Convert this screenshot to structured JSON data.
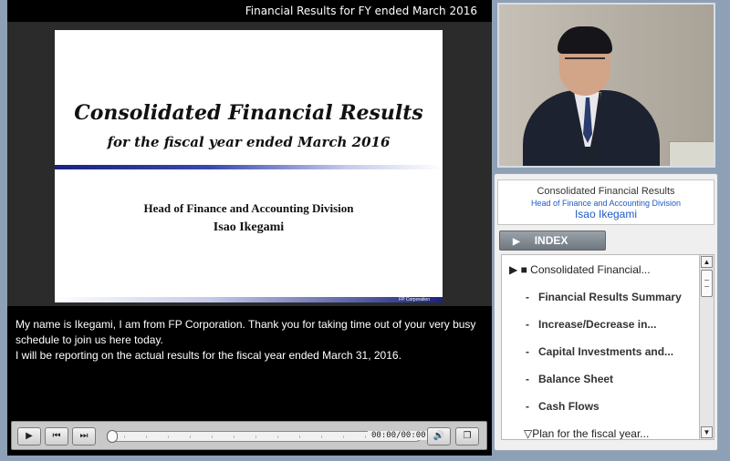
{
  "header": {
    "title": "Financial Results for FY ended March 2016"
  },
  "slide": {
    "title": "Consolidated Financial Results",
    "subtitle": "for the fiscal year ended March 2016",
    "presenter_role": "Head of Finance and Accounting Division",
    "presenter_name": "Isao Ikegami",
    "footer_logo": "FP Corporation"
  },
  "caption": {
    "lines": [
      "My name is Ikegami, I am from FP Corporation. Thank you for taking time out of your very busy",
      "schedule to join us here today.",
      "I will be reporting on the actual results for the fiscal year ended March 31, 2016."
    ]
  },
  "player": {
    "time": "00:00/00:00",
    "progress": 0,
    "icons": {
      "play": "play-icon",
      "prev": "previous-icon",
      "next": "next-icon",
      "volume": "volume-icon",
      "window": "window-icon"
    }
  },
  "info": {
    "title": "Consolidated Financial Results",
    "role": "Head of Finance and Accounting Division",
    "name": "Isao Ikegami"
  },
  "index": {
    "label": "INDEX",
    "items": [
      {
        "label": "Consolidated Financial...",
        "prefix": "▶ ■",
        "level": "section"
      },
      {
        "label": "Financial Results Summary",
        "prefix": "-",
        "level": "sub"
      },
      {
        "label": "Increase/Decrease in...",
        "prefix": "-",
        "level": "sub"
      },
      {
        "label": "Capital Investments and...",
        "prefix": "-",
        "level": "sub"
      },
      {
        "label": "Balance Sheet",
        "prefix": "-",
        "level": "sub"
      },
      {
        "label": "Cash Flows",
        "prefix": "-",
        "level": "sub"
      },
      {
        "label": "Plan for the fiscal year...",
        "prefix": "▽",
        "level": "section"
      }
    ]
  },
  "colors": {
    "link_blue": "#1e5bc6",
    "panel_bg": "#efefef",
    "page_bg": "#8da0b5"
  }
}
